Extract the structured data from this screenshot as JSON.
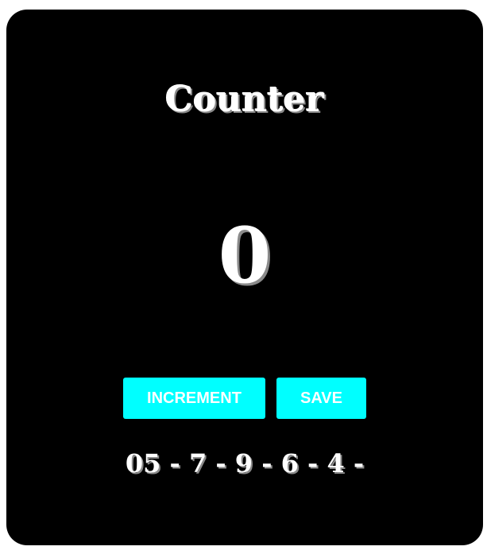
{
  "app": {
    "title": "Counter",
    "count": "0",
    "increment_label": "INCREMENT",
    "save_label": "SAVE",
    "history_text": "05 - 7 - 9 - 6 - 4 -"
  },
  "colors": {
    "background": "#000000",
    "button": "#00ffff",
    "text": "#ffffff"
  }
}
